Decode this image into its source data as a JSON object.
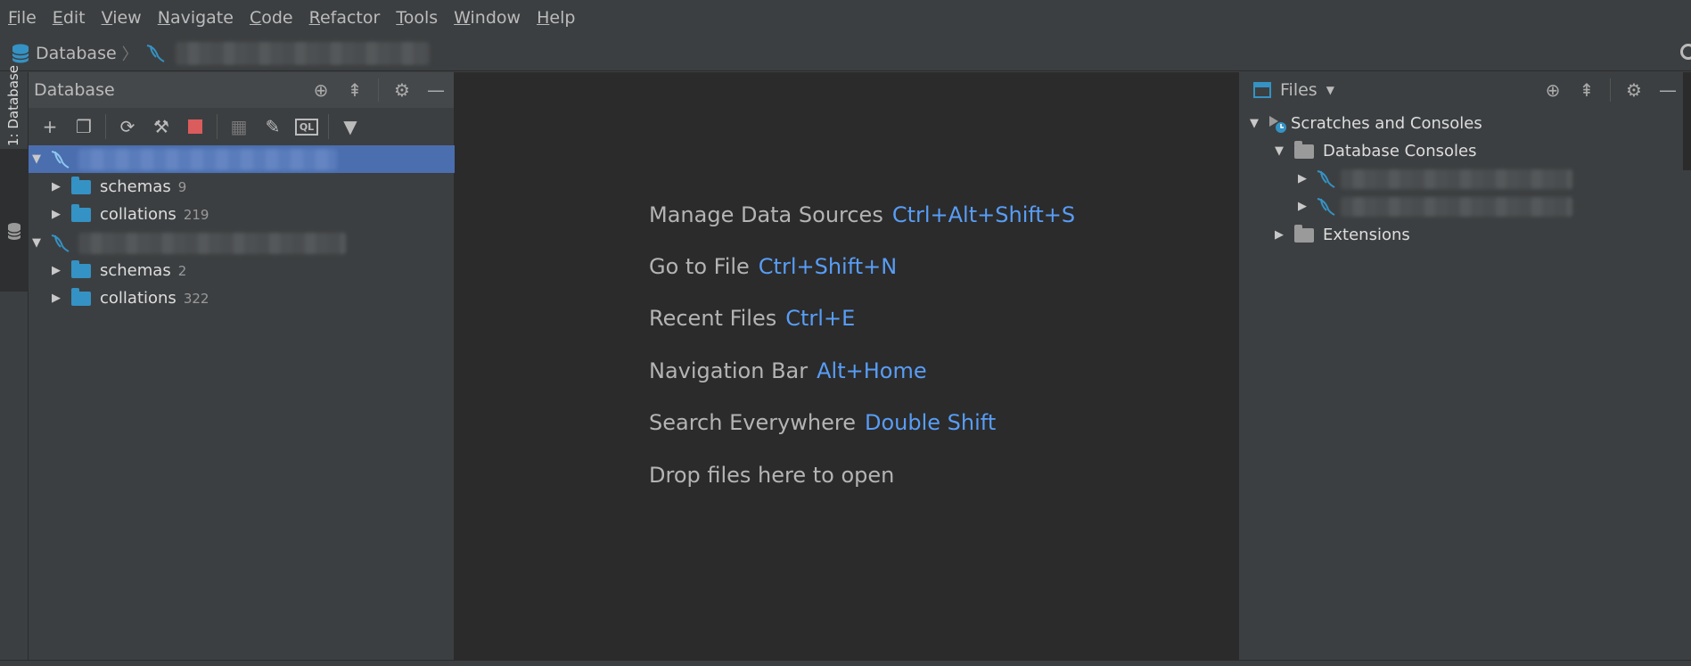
{
  "menu": [
    "File",
    "Edit",
    "View",
    "Navigate",
    "Code",
    "Refactor",
    "Tools",
    "Window",
    "Help"
  ],
  "menu_mnemonics": [
    "F",
    "E",
    "V",
    "N",
    "C",
    "R",
    "T",
    "W",
    "H"
  ],
  "navbar": {
    "root_label": "Database"
  },
  "left_stripe": {
    "tab_label": "1: Database"
  },
  "database_panel": {
    "title": "Database",
    "tree": [
      {
        "type": "datasource",
        "children": [
          {
            "label": "schemas",
            "count": "9"
          },
          {
            "label": "collations",
            "count": "219"
          }
        ]
      },
      {
        "type": "datasource",
        "children": [
          {
            "label": "schemas",
            "count": "2"
          },
          {
            "label": "collations",
            "count": "322"
          }
        ]
      }
    ]
  },
  "editor": {
    "hints": [
      {
        "text": "Manage Data Sources",
        "shortcut": "Ctrl+Alt+Shift+S"
      },
      {
        "text": "Go to File",
        "shortcut": "Ctrl+Shift+N"
      },
      {
        "text": "Recent Files",
        "shortcut": "Ctrl+E"
      },
      {
        "text": "Navigation Bar",
        "shortcut": "Alt+Home"
      },
      {
        "text": "Search Everywhere",
        "shortcut": "Double Shift"
      },
      {
        "text": "Drop files here to open",
        "shortcut": ""
      }
    ]
  },
  "files_panel": {
    "title": "Files",
    "tree": {
      "root": "Scratches and Consoles",
      "consoles": "Database Consoles",
      "extensions": "Extensions"
    }
  },
  "colors": {
    "accent": "#589df6",
    "selection": "#4b6eaf",
    "folder": "#3592c4",
    "stop": "#db5c5c"
  }
}
